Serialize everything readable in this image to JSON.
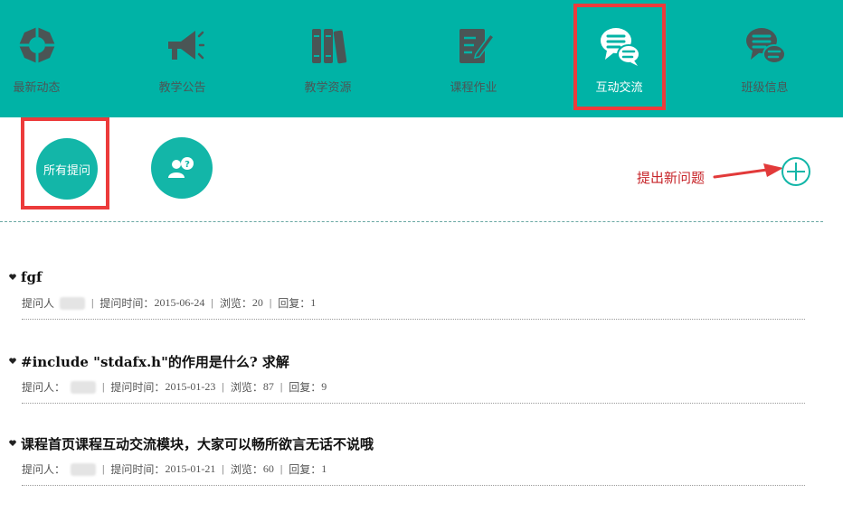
{
  "nav": {
    "items": [
      {
        "label": "最新动态",
        "icon": "camera-aperture-icon"
      },
      {
        "label": "教学公告",
        "icon": "megaphone-icon"
      },
      {
        "label": "教学资源",
        "icon": "books-icon"
      },
      {
        "label": "课程作业",
        "icon": "notebook-pen-icon"
      },
      {
        "label": "互动交流",
        "icon": "chat-bubbles-icon"
      },
      {
        "label": "班级信息",
        "icon": "chat-bubbles-icon"
      }
    ],
    "active_index": 4
  },
  "filters": {
    "all_questions_label": "所有提问",
    "my_questions_icon": "user-question-icon"
  },
  "annotation": {
    "new_question_label": "提出新问题"
  },
  "questions": [
    {
      "title": "fgf",
      "asker_label": "提问人",
      "time_label": "提问时间：",
      "time": "2015-06-24",
      "views_label": "浏览：",
      "views": "20",
      "replies_label": "回复：",
      "replies": "1"
    },
    {
      "title": "#include \"stdafx.h\"的作用是什么? 求解",
      "asker_label": "提问人：",
      "time_label": "提问时间：",
      "time": "2015-01-23",
      "views_label": "浏览：",
      "views": "87",
      "replies_label": "回复：",
      "replies": "9"
    },
    {
      "title": "课程首页课程互动交流模块，大家可以畅所欲言无话不说哦",
      "asker_label": "提问人：",
      "time_label": "提问时间：",
      "time": "2015-01-21",
      "views_label": "浏览：",
      "views": "60",
      "replies_label": "回复：",
      "replies": "1"
    }
  ],
  "colors": {
    "teal": "#00b3a6",
    "circle_teal": "#13b6a8",
    "annotation_red": "#ec3b3b"
  }
}
